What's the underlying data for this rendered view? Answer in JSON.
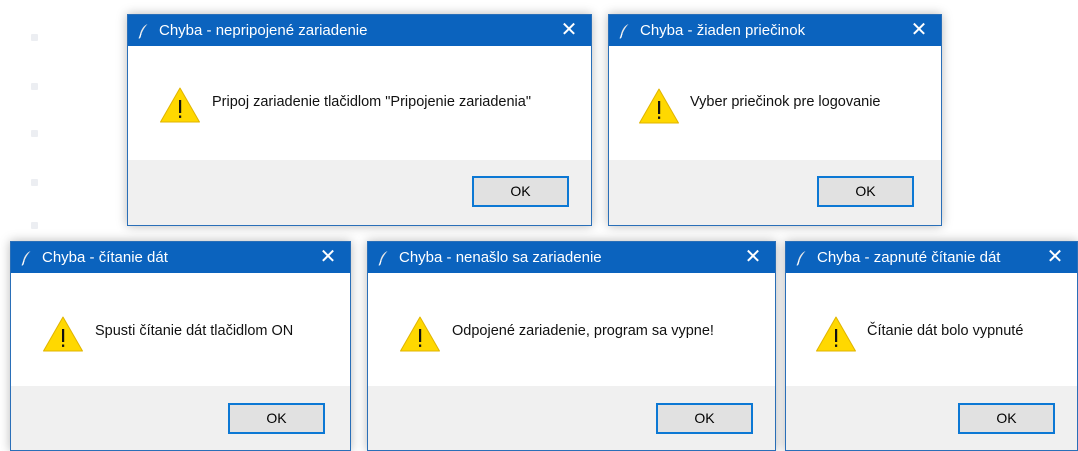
{
  "icons": {
    "app": "feather-icon",
    "warning": "warning-icon",
    "close": "close-icon"
  },
  "colors": {
    "titlebar": "#0b63be",
    "footer": "#f0f0f0",
    "button_border": "#0c78d4",
    "button_face": "#e1e1e1",
    "warning_fill": "#ffd800"
  },
  "dialogs": [
    {
      "title": "Chyba - nepripojené zariadenie",
      "close_label": "✕",
      "message": "Pripoj zariadenie tlačidlom \"Pripojenie zariadenia\"",
      "ok_label": "OK"
    },
    {
      "title": "Chyba - žiaden priečinok",
      "close_label": "✕",
      "message": "Vyber priečinok pre logovanie",
      "ok_label": "OK"
    },
    {
      "title": "Chyba - čítanie dát",
      "close_label": "✕",
      "message": "Spusti čítanie dát tlačidlom ON",
      "ok_label": "OK"
    },
    {
      "title": "Chyba - nenašlo sa zariadenie",
      "close_label": "✕",
      "message": "Odpojené zariadenie, program sa vypne!",
      "ok_label": "OK"
    },
    {
      "title": "Chyba - zapnuté čítanie dát",
      "close_label": "✕",
      "message": "Čítanie dát bolo vypnuté",
      "ok_label": "OK"
    }
  ]
}
